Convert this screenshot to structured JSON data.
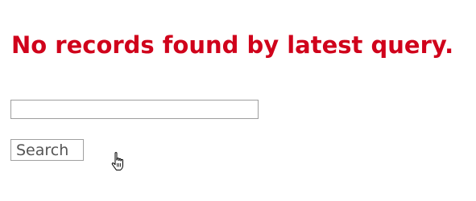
{
  "message": {
    "text": "No records found by latest query.",
    "color": "#d0021b"
  },
  "search": {
    "input_value": "",
    "button_label": "Search"
  },
  "cursor": {
    "icon": "hand-pointer-icon"
  }
}
